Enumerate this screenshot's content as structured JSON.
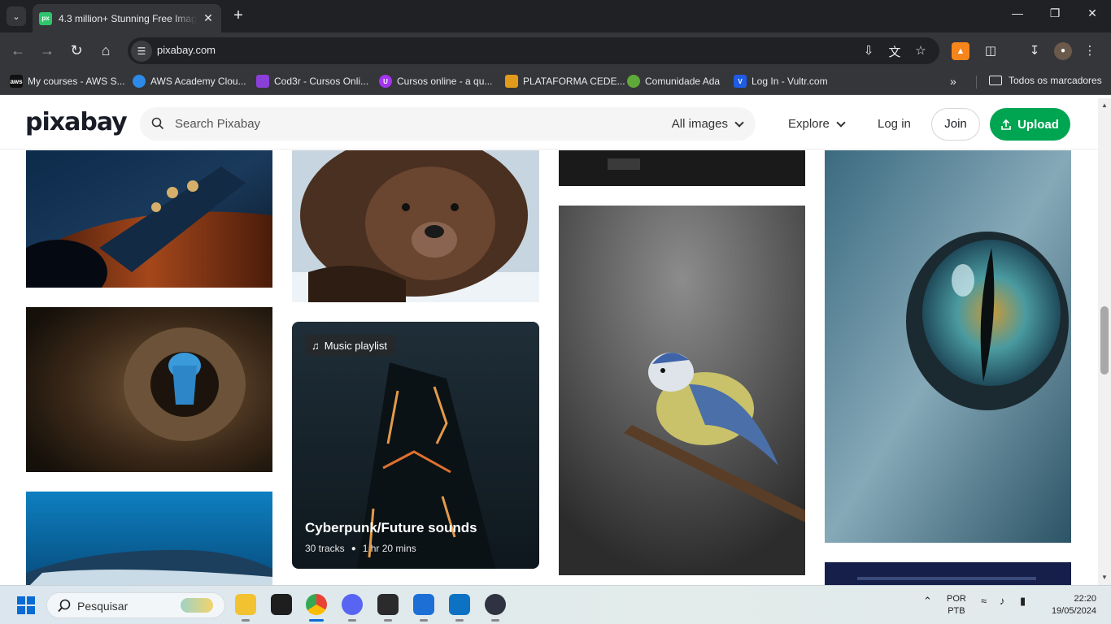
{
  "browser": {
    "tab_title": "4.3 million+ Stunning Free Images",
    "tab_favicon": "px",
    "url": "pixabay.com",
    "bookmarks": [
      {
        "label": "My courses - AWS S...",
        "icon": "aws-icon"
      },
      {
        "label": "AWS Academy Clou...",
        "icon": "cloud-icon"
      },
      {
        "label": "Cod3r - Cursos Onli...",
        "icon": "cod3r-icon"
      },
      {
        "label": "Cursos online - a qu...",
        "icon": "udemy-icon"
      },
      {
        "label": "PLATAFORMA CEDE...",
        "icon": "cede-icon"
      },
      {
        "label": "Comunidade Ada",
        "icon": "ada-icon"
      },
      {
        "label": "Log In - Vultr.com",
        "icon": "vultr-icon"
      }
    ],
    "all_bookmarks": "Todos os marcadores"
  },
  "site": {
    "logo": "pixabay",
    "search_placeholder": "Search Pixabay",
    "filter": "All images",
    "explore": "Explore",
    "login": "Log in",
    "join": "Join",
    "upload": "Upload"
  },
  "playlist": {
    "badge": "Music playlist",
    "title": "Cyberpunk/Future sounds",
    "tracks": "30 tracks",
    "duration": "1 hr 20 mins"
  },
  "taskbar": {
    "search": "Pesquisar",
    "lang1": "POR",
    "lang2": "PTB",
    "time": "22:20",
    "date": "19/05/2024"
  },
  "colors": {
    "brand_green": "#00a551",
    "chrome_dark": "#202124",
    "chrome_toolbar": "#35363a"
  }
}
